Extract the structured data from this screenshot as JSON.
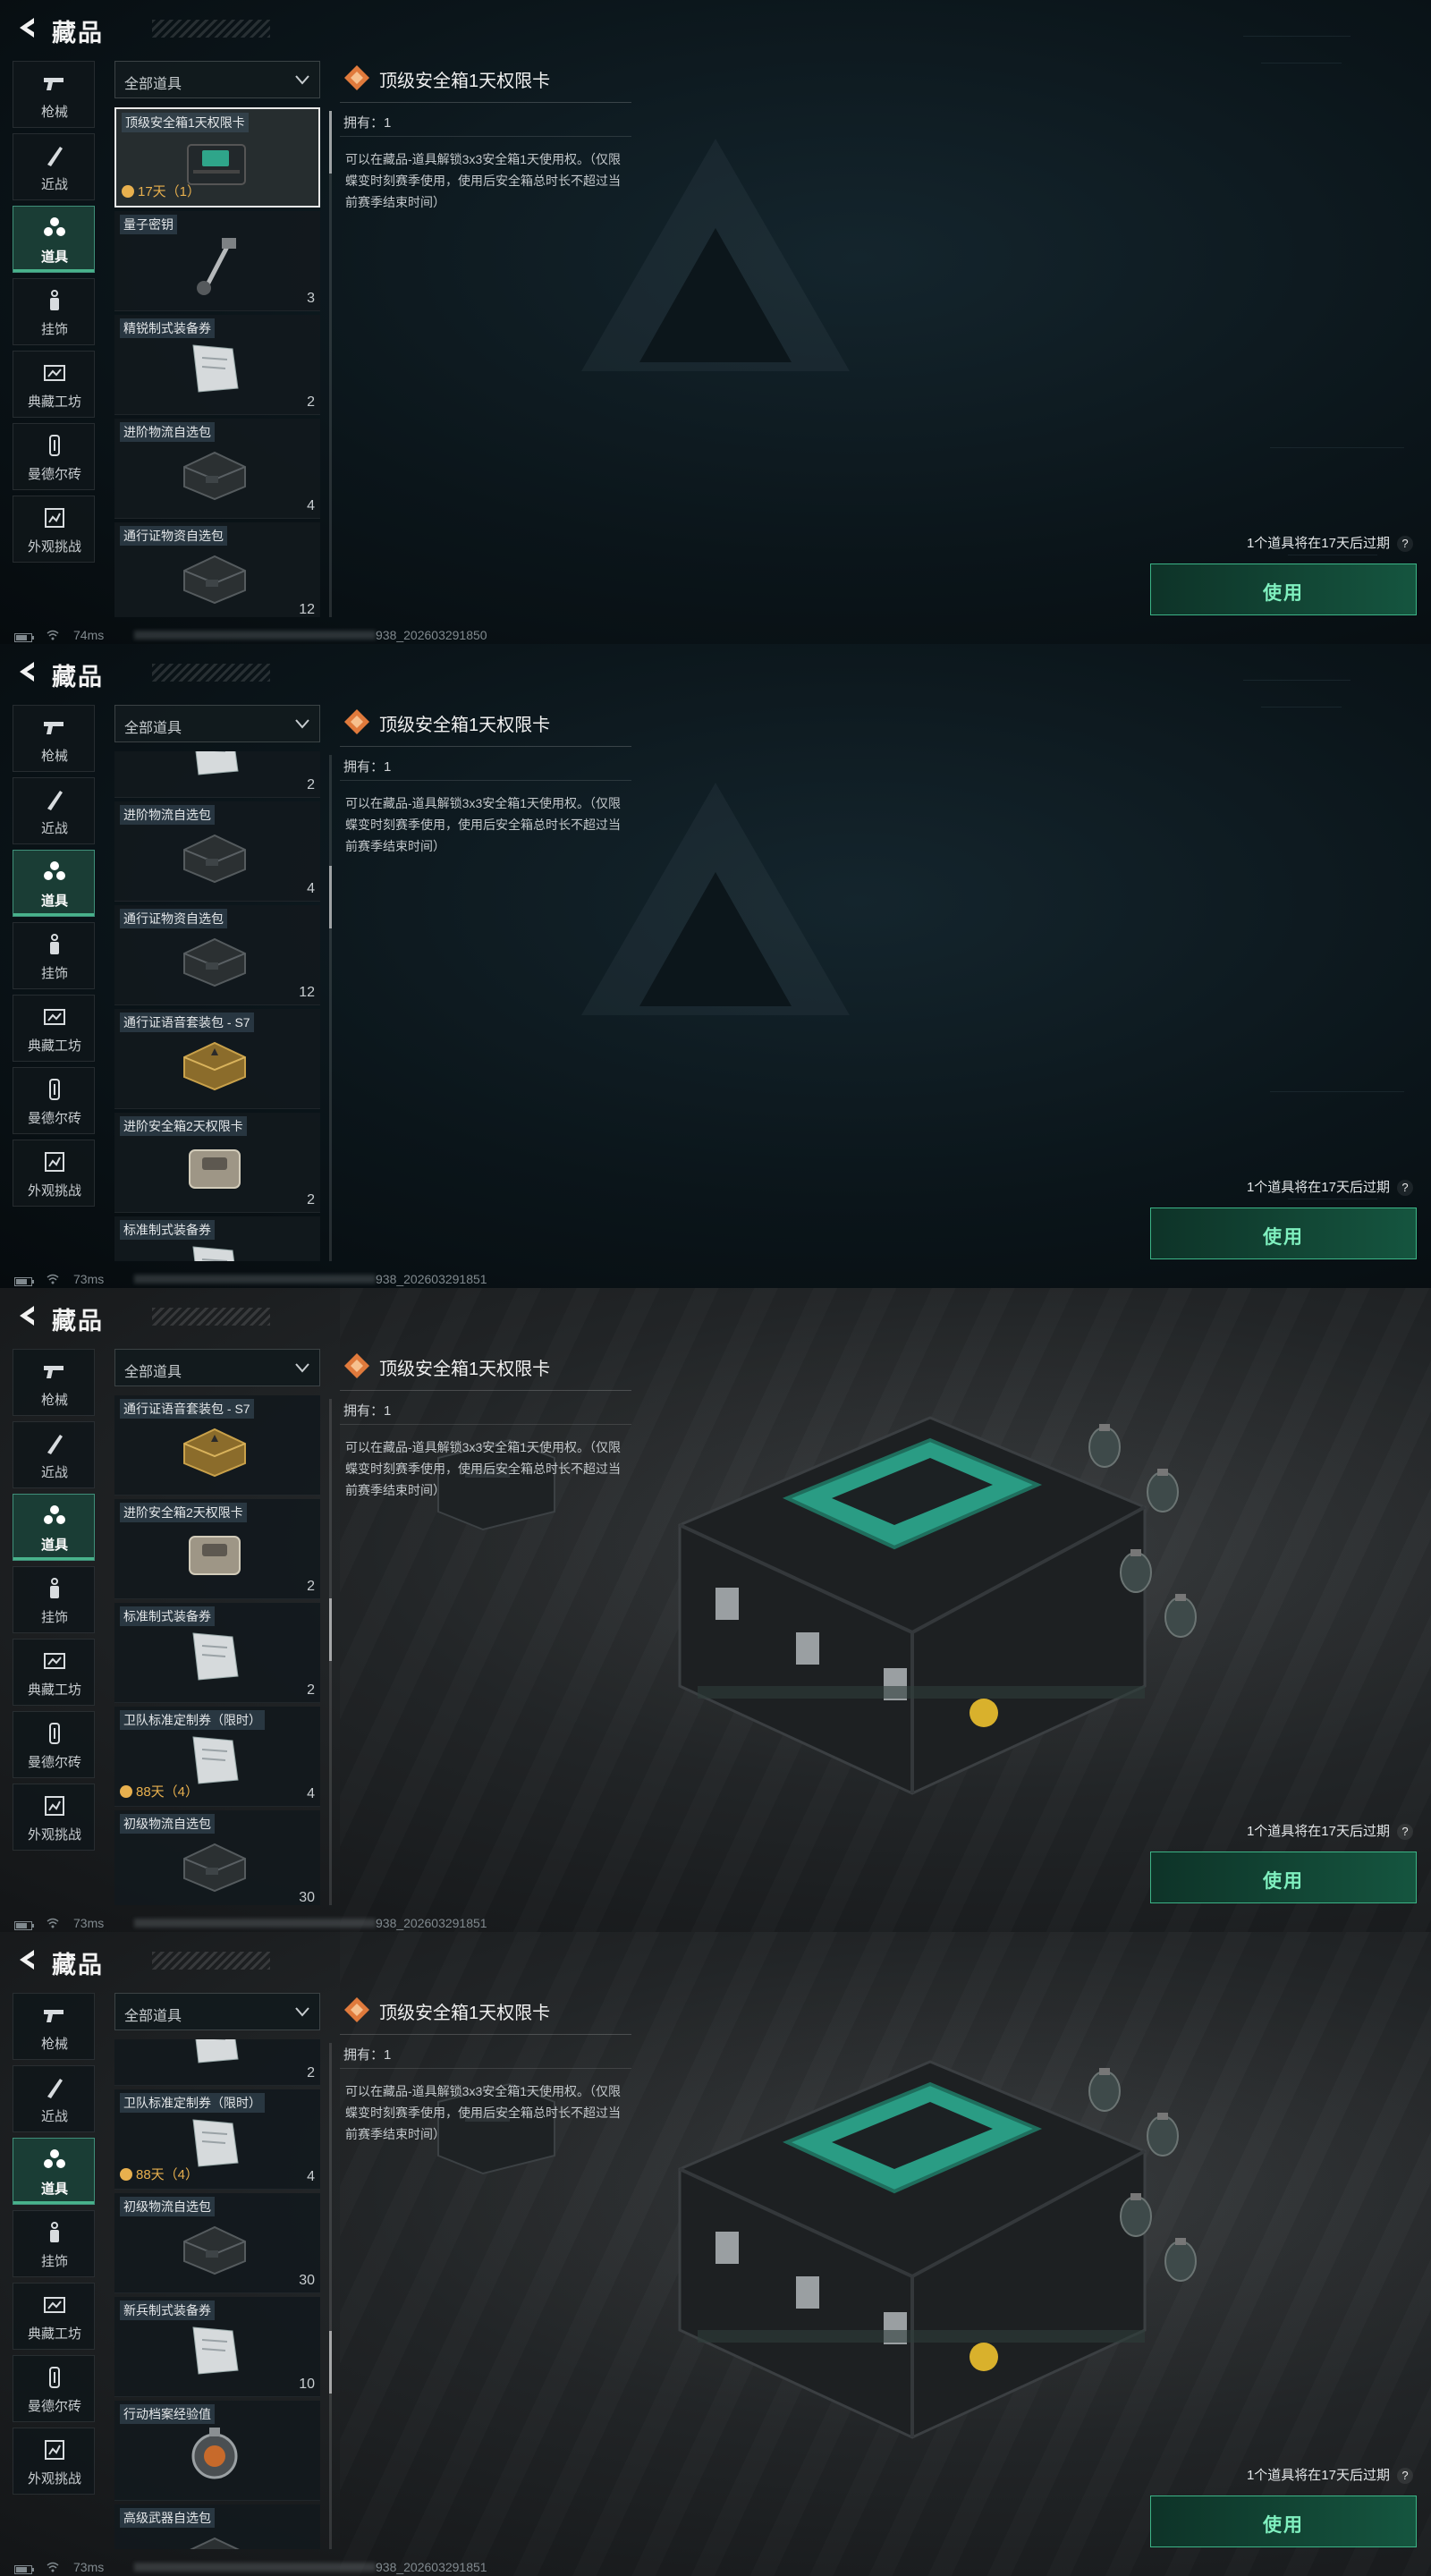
{
  "header": {
    "title": "藏品"
  },
  "sidebar": {
    "items": [
      {
        "label": "枪械",
        "icon": "gun-icon"
      },
      {
        "label": "近战",
        "icon": "knife-icon"
      },
      {
        "label": "道具",
        "icon": "items-icon"
      },
      {
        "label": "挂饰",
        "icon": "charm-icon"
      },
      {
        "label": "典藏工坊",
        "icon": "workshop-icon"
      },
      {
        "label": "曼德尔砖",
        "icon": "brick-icon"
      },
      {
        "label": "外观挑战",
        "icon": "challenge-icon"
      }
    ],
    "active_index": 2
  },
  "filter": {
    "label": "全部道具"
  },
  "detail": {
    "title": "顶级安全箱1天权限卡",
    "owned": "拥有：1",
    "description": "可以在藏品-道具解锁3x3安全箱1天使用权。（仅限蝶变时刻赛季使用，使用后安全箱总时长不超过当前赛季结束时间）"
  },
  "expiry_note": "1个道具将在17天后过期",
  "help_label": "?",
  "use_button": "使用",
  "colors": {
    "accent": "#49b38c",
    "timer": "#e8b04e",
    "use_text": "#7ff0bf"
  },
  "panels": [
    {
      "background": "dark",
      "ping": "74ms",
      "session": "938_202603291850",
      "scroll_fraction": 0.0,
      "items": [
        {
          "name": "顶级安全箱1天权限卡",
          "count": "",
          "timer": "17天（1）",
          "selected": true,
          "thumb": "crate-black-icon"
        },
        {
          "name": "量子密钥",
          "count": "3",
          "timer": "",
          "thumb": "key-icon"
        },
        {
          "name": "精锐制式装备券",
          "count": "2",
          "timer": "",
          "thumb": "ticket-icon"
        },
        {
          "name": "进阶物流自选包",
          "count": "4",
          "timer": "",
          "thumb": "case-dark-icon"
        },
        {
          "name": "通行证物资自选包",
          "count": "12",
          "timer": "",
          "thumb": "case-dark-icon"
        }
      ]
    },
    {
      "background": "dark",
      "ping": "73ms",
      "session": "938_202603291851",
      "scroll_fraction": 0.25,
      "items": [
        {
          "name": "",
          "count": "2",
          "timer": "",
          "thumb": "ticket-icon"
        },
        {
          "name": "进阶物流自选包",
          "count": "4",
          "timer": "",
          "thumb": "case-dark-icon"
        },
        {
          "name": "通行证物资自选包",
          "count": "12",
          "timer": "",
          "thumb": "case-dark-icon"
        },
        {
          "name": "通行证语音套装包 - S7",
          "count": "",
          "timer": "",
          "thumb": "case-gold-icon"
        },
        {
          "name": "进阶安全箱2天权限卡",
          "count": "2",
          "timer": "",
          "thumb": "crate-tan-icon"
        },
        {
          "name": "标准制式装备券",
          "count": "",
          "timer": "",
          "thumb": "ticket-icon"
        }
      ]
    },
    {
      "background": "scene",
      "ping": "73ms",
      "session": "938_202603291851",
      "scroll_fraction": 0.45,
      "items": [
        {
          "name": "通行证语音套装包 - S7",
          "count": "",
          "timer": "",
          "thumb": "case-gold-icon"
        },
        {
          "name": "进阶安全箱2天权限卡",
          "count": "2",
          "timer": "",
          "thumb": "crate-tan-icon"
        },
        {
          "name": "标准制式装备券",
          "count": "2",
          "timer": "",
          "thumb": "ticket-icon"
        },
        {
          "name": "卫队标准定制券（限时）",
          "count": "4",
          "timer": "88天（4）",
          "thumb": "ticket-icon"
        },
        {
          "name": "初级物流自选包",
          "count": "30",
          "timer": "",
          "thumb": "case-dark-icon"
        }
      ]
    },
    {
      "background": "scene",
      "ping": "73ms",
      "session": "938_202603291851",
      "scroll_fraction": 0.65,
      "items": [
        {
          "name": "",
          "count": "2",
          "timer": "",
          "thumb": "ticket-icon"
        },
        {
          "name": "卫队标准定制券（限时）",
          "count": "4",
          "timer": "88天（4）",
          "thumb": "ticket-icon"
        },
        {
          "name": "初级物流自选包",
          "count": "30",
          "timer": "",
          "thumb": "case-dark-icon"
        },
        {
          "name": "新兵制式装备券",
          "count": "10",
          "timer": "",
          "thumb": "ticket-icon"
        },
        {
          "name": "行动档案经验值",
          "count": "",
          "timer": "",
          "thumb": "badge-icon"
        },
        {
          "name": "高级武器自选包",
          "count": "",
          "timer": "",
          "thumb": "case-dark-icon"
        }
      ]
    }
  ]
}
